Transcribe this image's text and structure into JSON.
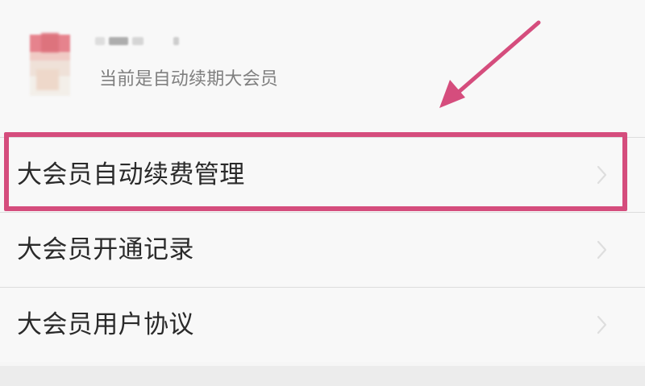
{
  "profile": {
    "status_text": "当前是自动续期大会员"
  },
  "menu": {
    "items": [
      {
        "label": "大会员自动续费管理",
        "icon": "chevron-right-icon"
      },
      {
        "label": "大会员开通记录",
        "icon": "chevron-right-icon"
      },
      {
        "label": "大会员用户协议",
        "icon": "chevron-right-icon"
      }
    ]
  },
  "colors": {
    "highlight": "#d54d7d",
    "primary_text": "#2a2a2a",
    "secondary_text": "#7f7f7f",
    "background": "#f6f6f6",
    "divider": "#dddddd"
  },
  "annotations": {
    "highlighted_item": "大会员自动续费管理",
    "arrow_icon": "annotation-arrow-icon"
  }
}
